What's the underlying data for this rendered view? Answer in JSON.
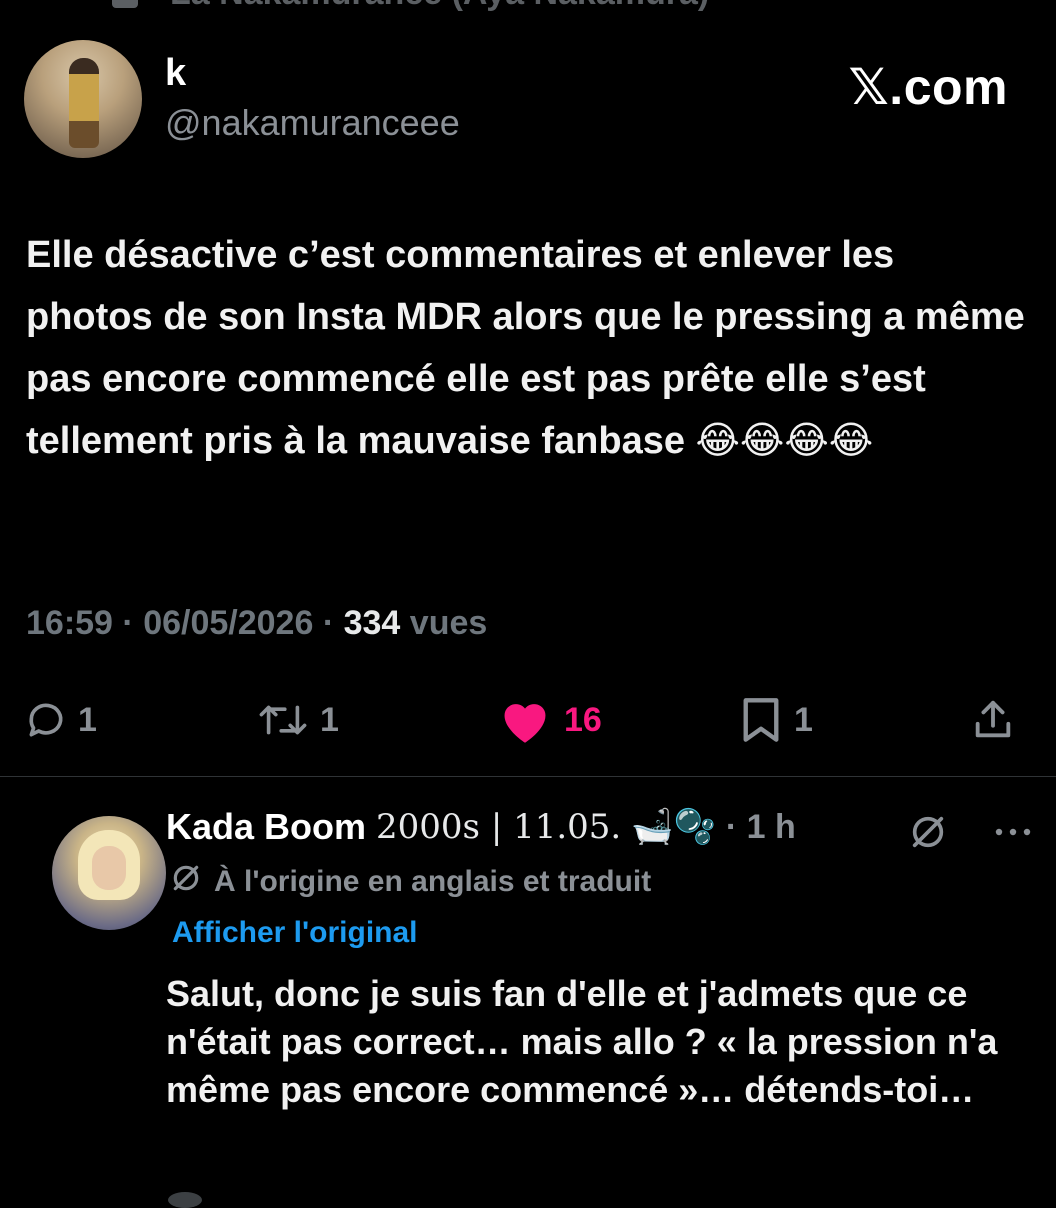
{
  "top_cut_text": "La Nakamurance (Aya Nakamura)",
  "post": {
    "display_name": "k",
    "handle": "@nakamuranceee",
    "brand": "𝕏.com",
    "text": "Elle désactive c’est  commentaires et enlever les photos de son Insta MDR alors que le pressing a même pas encore commencé elle est pas prête elle s’est tellement pris à la mauvaise fanbase 😂😂😂😂",
    "time": "16:59",
    "separator": "·",
    "date": "06/05/2026",
    "views_count": "334",
    "views_label": "vues"
  },
  "actions": {
    "replies": "1",
    "reposts": "1",
    "likes": "16",
    "bookmarks": "1"
  },
  "reply": {
    "display_name": "Kada Boom",
    "name_suffix": "2000s | 11.05.",
    "emoji": "🛁🫧",
    "time": "· 1 h",
    "translated_note": "À l'origine en anglais et traduit",
    "show_original": "Afficher l'original",
    "text": "Salut, donc je suis fan d'elle et j'admets que ce n'était pas correct… mais allo ? « la pression n'a même pas encore commencé »… détends-toi…"
  },
  "icons": {
    "reply": "speech-bubble-icon",
    "repost": "repost-arrows-icon",
    "like": "heart-icon",
    "bookmark": "bookmark-icon",
    "share": "share-upload-icon",
    "translate": "grok-slash-icon",
    "more": "more-dots-icon"
  },
  "colors": {
    "background": "#000000",
    "like": "#f91880",
    "link": "#1d9bf0",
    "muted": "#8b9096"
  }
}
